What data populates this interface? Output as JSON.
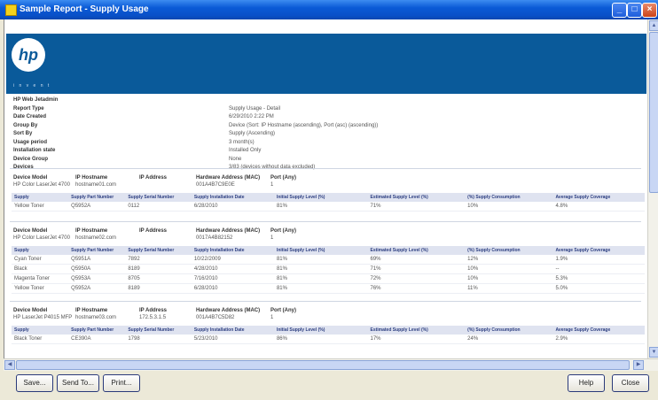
{
  "window": {
    "title": "Sample Report - Supply Usage"
  },
  "logo": {
    "mark": "hp",
    "tagline": "i n v e n t"
  },
  "report": {
    "heading": "HP Web Jetadmin",
    "fields": [
      {
        "label": "Report Type",
        "value": "Supply Usage - Detail"
      },
      {
        "label": "Date Created",
        "value": "6/29/2010 2:22 PM"
      },
      {
        "label": "Group By",
        "value": "Device (Sort: IP Hostname (ascending), Port (asc) (ascending))"
      },
      {
        "label": "Sort By",
        "value": "Supply (Ascending)"
      },
      {
        "label": "Usage period",
        "value": "3 month(s)"
      },
      {
        "label": "Installation state",
        "value": "Installed Only"
      },
      {
        "label": "Device Group",
        "value": "None"
      },
      {
        "label": "Devices",
        "value": "3/83 (devices without data excluded)"
      }
    ]
  },
  "device_header_labels": [
    "Device Model",
    "IP Hostname",
    "IP Address",
    "Hardware Address (MAC)",
    "Port (Any)"
  ],
  "supply_columns": [
    "Supply",
    "Supply Part Number",
    "Supply Serial Number",
    "Supply Installation Date",
    "Initial Supply Level (%)",
    "Estimated Supply Level (%)",
    "(%) Supply Consumption",
    "Average Supply Coverage"
  ],
  "devices": [
    {
      "model": "HP Color LaserJet 4700",
      "hostname": "hostname01.com",
      "ip": "",
      "mac": "001A4B7C9E0E",
      "port": "1",
      "rows": [
        [
          "Yellow Toner",
          "Q5952A",
          "0112",
          "6/28/2010",
          "81%",
          "71%",
          "10%",
          "4.8%"
        ]
      ]
    },
    {
      "model": "HP Color LaserJet 4700",
      "hostname": "hostname02.com",
      "ip": "",
      "mac": "0017A4B82152",
      "port": "1",
      "rows": [
        [
          "Cyan Toner",
          "Q5951A",
          "7892",
          "10/22/2009",
          "81%",
          "69%",
          "12%",
          "1.9%"
        ],
        [
          "Black",
          "Q5950A",
          "8189",
          "4/28/2010",
          "81%",
          "71%",
          "10%",
          "--"
        ],
        [
          "Magenta Toner",
          "Q5953A",
          "8705",
          "7/16/2010",
          "81%",
          "72%",
          "10%",
          "5.3%"
        ],
        [
          "Yellow Toner",
          "Q5952A",
          "8189",
          "6/28/2010",
          "81%",
          "76%",
          "11%",
          "5.0%"
        ]
      ]
    },
    {
      "model": "HP LaserJet P4015 MFP",
      "hostname": "hostname03.com",
      "ip": "172.5.3.1.5",
      "mac": "001A4B7C5D82",
      "port": "1",
      "rows": [
        [
          "Black Toner",
          "CE390A",
          "1798",
          "5/23/2010",
          "86%",
          "17%",
          "24%",
          "2.9%"
        ]
      ]
    }
  ],
  "buttons": {
    "save": "Save...",
    "send_to": "Send To...",
    "print": "Print...",
    "help": "Help",
    "close": "Close"
  }
}
